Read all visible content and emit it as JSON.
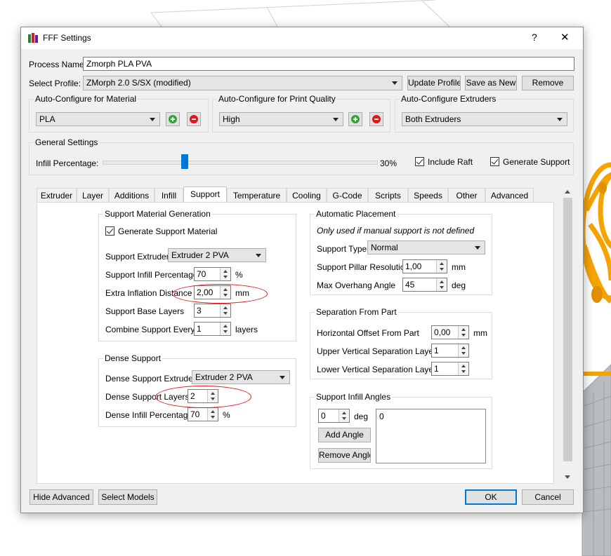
{
  "window": {
    "title": "FFF Settings",
    "help_glyph": "?",
    "close_glyph": "✕"
  },
  "process": {
    "name_label": "Process Name:",
    "name_value": "Zmorph PLA PVA",
    "profile_label": "Select Profile:",
    "profile_value": "ZMorph 2.0 S/SX (modified)",
    "update_button": "Update Profile",
    "save_as_new_button": "Save as New",
    "remove_button": "Remove"
  },
  "auto_configure": {
    "material": {
      "title": "Auto-Configure for Material",
      "value": "PLA"
    },
    "quality": {
      "title": "Auto-Configure for Print Quality",
      "value": "High"
    },
    "extruders": {
      "title": "Auto-Configure Extruders",
      "value": "Both Extruders"
    }
  },
  "general_settings": {
    "title": "General Settings",
    "infill_label": "Infill Percentage:",
    "infill_value": 0.3,
    "infill_text": "30%",
    "include_raft": "Include Raft",
    "generate_support": "Generate Support"
  },
  "tabs": [
    {
      "label": "Extruder"
    },
    {
      "label": "Layer"
    },
    {
      "label": "Additions"
    },
    {
      "label": "Infill"
    },
    {
      "label": "Support"
    },
    {
      "label": "Temperature"
    },
    {
      "label": "Cooling"
    },
    {
      "label": "G-Code"
    },
    {
      "label": "Scripts"
    },
    {
      "label": "Speeds"
    },
    {
      "label": "Other"
    },
    {
      "label": "Advanced"
    }
  ],
  "support_material_generation": {
    "title": "Support Material Generation",
    "generate_label": "Generate Support Material",
    "extruder_label": "Support Extruder",
    "extruder_value": "Extruder 2 PVA",
    "infill_pct_label": "Support Infill Percentage",
    "infill_pct_value": "70",
    "infill_pct_unit": "%",
    "inflation_label": "Extra Inflation Distance",
    "inflation_value": "2,00",
    "inflation_unit": "mm",
    "base_layers_label": "Support Base Layers",
    "base_layers_value": "3",
    "combine_label": "Combine Support Every",
    "combine_value": "1",
    "combine_unit": "layers"
  },
  "dense_support": {
    "title": "Dense Support",
    "extruder_label": "Dense Support Extruder",
    "extruder_value": "Extruder 2 PVA",
    "layers_label": "Dense Support Layers",
    "layers_value": "2",
    "infill_label": "Dense Infill Percentage",
    "infill_value": "70",
    "infill_unit": "%"
  },
  "automatic_placement": {
    "title": "Automatic Placement",
    "note": "Only used if manual support is not defined",
    "type_label": "Support Type",
    "type_value": "Normal",
    "pillar_label": "Support Pillar Resolution",
    "pillar_value": "1,00",
    "pillar_unit": "mm",
    "overhang_label": "Max Overhang Angle",
    "overhang_value": "45",
    "overhang_unit": "deg"
  },
  "separation": {
    "title": "Separation From Part",
    "horizontal_label": "Horizontal Offset From Part",
    "horizontal_value": "0,00",
    "horizontal_unit": "mm",
    "upper_label": "Upper Vertical Separation Layers",
    "upper_value": "1",
    "lower_label": "Lower Vertical Separation Layers",
    "lower_value": "1"
  },
  "infill_angles": {
    "title": "Support Infill Angles",
    "angle_value": "0",
    "angle_unit": "deg",
    "add_button": "Add Angle",
    "remove_button": "Remove Angle",
    "list_items": [
      "0"
    ]
  },
  "footer": {
    "hide_advanced": "Hide Advanced",
    "select_models": "Select Models",
    "ok": "OK",
    "cancel": "Cancel"
  },
  "colors": {
    "accent": "#0078d7",
    "add_green": "#2ea832",
    "remove_red": "#e0181b",
    "annotation_red": "#e3151a",
    "model_orange": "#f5a300"
  }
}
